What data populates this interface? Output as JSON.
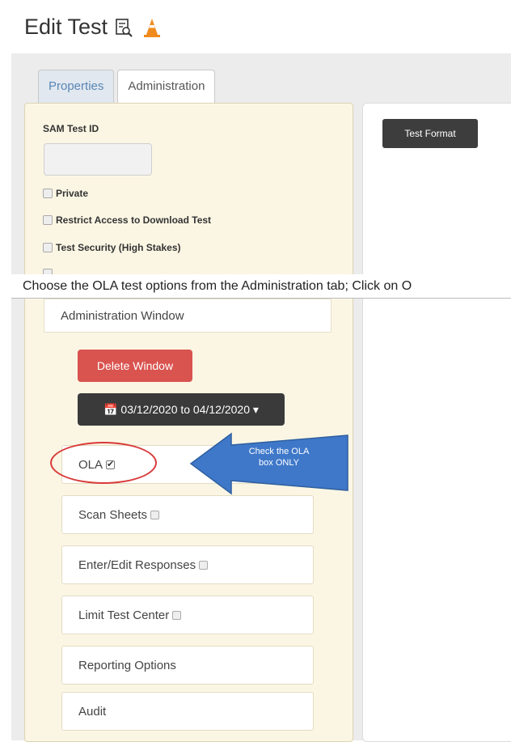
{
  "page": {
    "title": "Edit Test"
  },
  "tabs": [
    {
      "label": "Properties",
      "active": false
    },
    {
      "label": "Administration",
      "active": true
    }
  ],
  "left": {
    "sam_test_id_label": "SAM Test ID",
    "sam_test_id_value": "",
    "checkboxes": [
      {
        "label": "Private",
        "checked": false
      },
      {
        "label": "Restrict Access to Download Test",
        "checked": false
      },
      {
        "label": "Test Security (High Stakes)",
        "checked": false
      }
    ]
  },
  "right": {
    "test_format_label": "Test Format"
  },
  "caption": "Choose the OLA test options from the Administration tab; Click on O",
  "admin_window": {
    "header": "Administration Window",
    "delete_label": "Delete Window",
    "date_range": "03/12/2020 to 04/12/2020"
  },
  "options": [
    {
      "label": "OLA",
      "checkbox": true,
      "checked": true
    },
    {
      "label": "Scan Sheets",
      "checkbox": true,
      "checked": false
    },
    {
      "label": "Enter/Edit Responses",
      "checkbox": true,
      "checked": false
    },
    {
      "label": "Limit Test Center",
      "checkbox": true,
      "checked": false
    },
    {
      "label": "Reporting Options",
      "checkbox": false,
      "checked": false
    },
    {
      "label": "Audit",
      "checkbox": false,
      "checked": false
    }
  ],
  "callout": {
    "line1": "Check the OLA",
    "line2": "box ONLY"
  },
  "colors": {
    "danger": "#d9534f",
    "dark": "#3d3d3d",
    "panel": "#fbf6e4",
    "arrow": "#3f78c9",
    "circle": "#d93a3a"
  }
}
